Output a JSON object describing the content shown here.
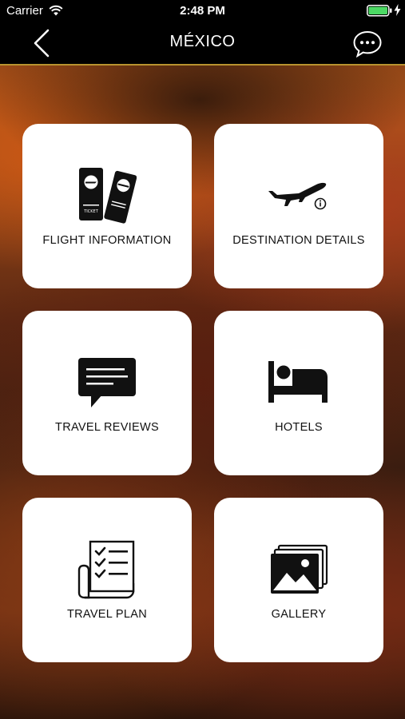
{
  "status_bar": {
    "carrier": "Carrier",
    "time": "2:48 PM",
    "wifi_icon": "wifi-icon",
    "battery_icon": "battery-icon",
    "charging_icon": "charging-bolt-icon"
  },
  "nav": {
    "title": "MÉXICO",
    "back_icon": "chevron-left-icon",
    "chat_icon": "chat-bubble-icon",
    "accent_color": "#b8932f"
  },
  "menu": {
    "items": [
      {
        "label": "FLIGHT INFORMATION",
        "icon": "tickets-icon"
      },
      {
        "label": "DESTINATION DETAILS",
        "icon": "airplane-info-icon"
      },
      {
        "label": "TRAVEL REVIEWS",
        "icon": "message-icon"
      },
      {
        "label": "HOTELS",
        "icon": "bed-icon"
      },
      {
        "label": "TRAVEL PLAN",
        "icon": "checklist-icon"
      },
      {
        "label": "GALLERY",
        "icon": "photo-gallery-icon"
      }
    ]
  }
}
